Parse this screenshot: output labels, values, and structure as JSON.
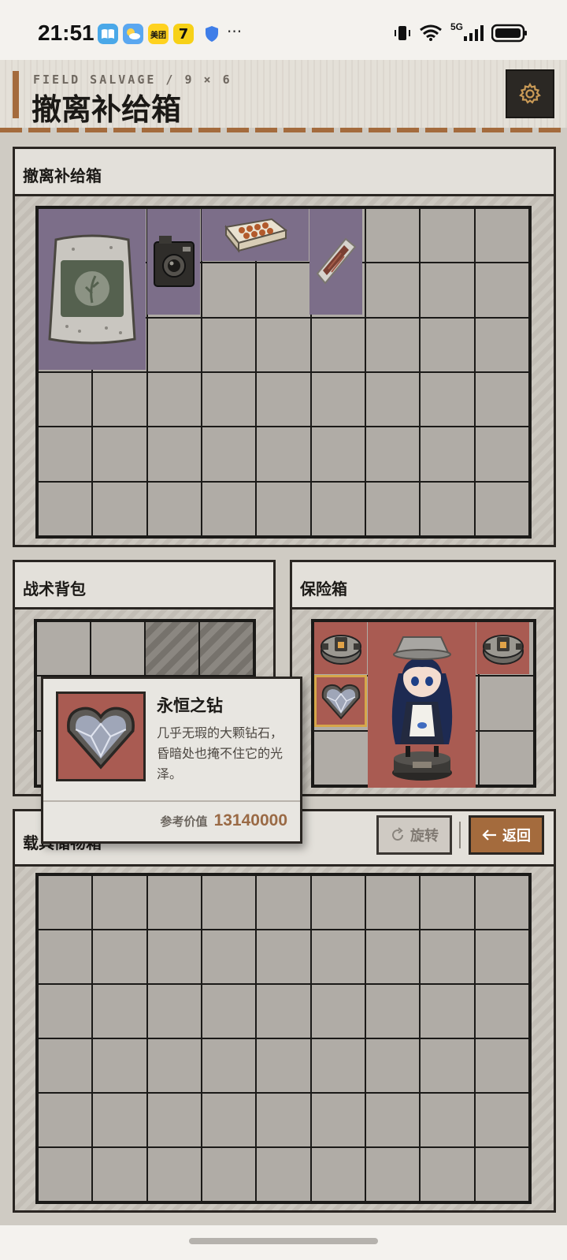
{
  "status_bar": {
    "time": "21:51",
    "apps": [
      {
        "name": "book-app-icon",
        "label": "",
        "color": "#4aa8e8"
      },
      {
        "name": "weather-app-icon",
        "label": "",
        "color": "#f2c24a"
      },
      {
        "name": "meituan-app-icon",
        "label": "美团",
        "color": "#ffd21f"
      },
      {
        "name": "seven-app-icon",
        "label": "7",
        "color": "#f7d117"
      }
    ],
    "more": "···",
    "network": "5G"
  },
  "header": {
    "eyebrow": "FIELD SALVAGE / 9 × 6",
    "title": "撤离补给箱"
  },
  "supply_panel": {
    "title": "撤离补给箱",
    "grid": {
      "cols": 9,
      "rows": 6
    },
    "items": [
      {
        "name": "sandbag-item",
        "icon": "sack",
        "col": 0,
        "row": 0,
        "w": 2,
        "h": 3
      },
      {
        "name": "camera-item",
        "icon": "camera",
        "col": 2,
        "row": 0,
        "w": 1,
        "h": 2
      },
      {
        "name": "food-box-item",
        "icon": "food-box",
        "col": 3,
        "row": 0,
        "w": 2,
        "h": 1
      },
      {
        "name": "jerky-item",
        "icon": "jerky",
        "col": 5,
        "row": 0,
        "w": 1,
        "h": 2
      }
    ]
  },
  "backpack_panel": {
    "title": "战术背包",
    "grid": {
      "cols": 4,
      "rows": 3
    },
    "locked": [
      2,
      3
    ]
  },
  "safe_panel": {
    "title": "保险箱",
    "items": [
      {
        "name": "gear-device-item-left",
        "icon": "device"
      },
      {
        "name": "diamond-item",
        "icon": "diamond",
        "selected": true
      },
      {
        "name": "figurine-item",
        "icon": "figurine"
      },
      {
        "name": "gear-device-item-right",
        "icon": "device"
      }
    ]
  },
  "cargo_panel": {
    "title": "载具储物箱",
    "rotate_label": "旋转",
    "back_label": "返回",
    "grid": {
      "cols": 9,
      "rows": 6
    }
  },
  "tooltip": {
    "name": "永恒之钻",
    "description": "几乎无瑕的大颗钻石，昏暗处也掩不住它的光泽。",
    "value_label": "参考价值",
    "value": "13140000"
  },
  "colors": {
    "accent": "#a46b3d",
    "purple_slot": "#7c6e89",
    "red_slot": "#a95b52",
    "select": "#d6a64a"
  }
}
